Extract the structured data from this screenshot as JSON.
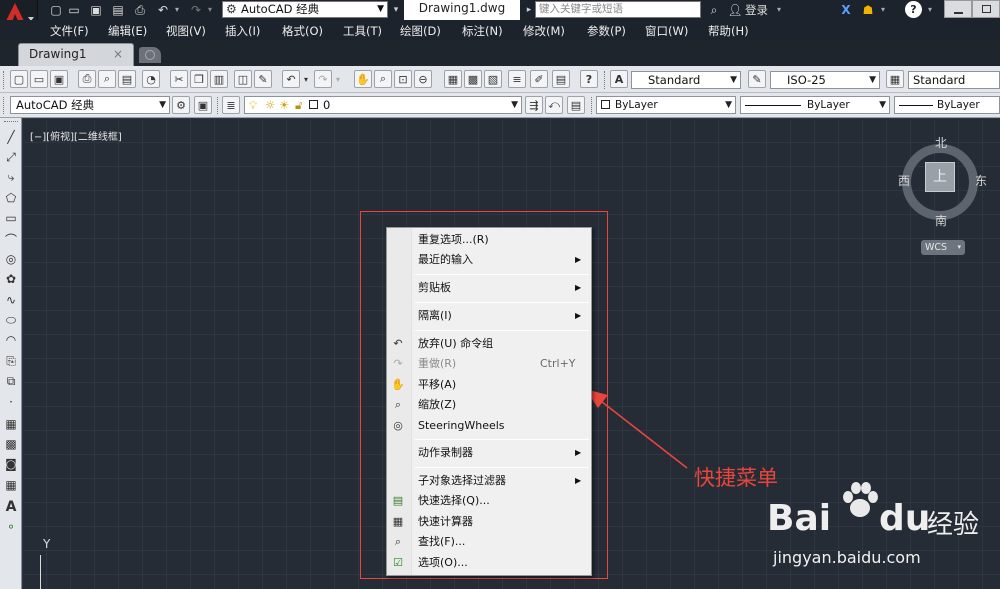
{
  "app": {
    "workspace": "AutoCAD 经典",
    "file_title": "Drawing1.dwg",
    "search_placeholder": "键入关键字或短语",
    "login": "登录"
  },
  "menubar": [
    "文件(F)",
    "编辑(E)",
    "视图(V)",
    "插入(I)",
    "格式(O)",
    "工具(T)",
    "绘图(D)",
    "标注(N)",
    "修改(M)",
    "参数(P)",
    "窗口(W)",
    "帮助(H)"
  ],
  "tabs": [
    {
      "label": "Drawing1",
      "close": "×"
    }
  ],
  "styles": {
    "text_style": "Standard",
    "dim_style": "ISO-25",
    "table_style": "Standard"
  },
  "toolbar2": {
    "workspace": "AutoCAD 经典",
    "layer": "0",
    "color": "ByLayer",
    "linetype": "ByLayer",
    "lineweight": "ByLayer"
  },
  "viewport_label": "[−][俯视][二维线框]",
  "viewcube": {
    "north": "北",
    "south": "南",
    "west": "西",
    "east": "东",
    "top": "上",
    "wcs": "WCS"
  },
  "ucs_y": "Y",
  "context_menu": {
    "repeat": "重复选项...(R)",
    "recent_input": "最近的输入",
    "clipboard": "剪贴板",
    "isolate": "隔离(I)",
    "undo": "放弃(U) 命令组",
    "redo": "重做(R)",
    "redo_shortcut": "Ctrl+Y",
    "pan": "平移(A)",
    "zoom": "缩放(Z)",
    "steering": "SteeringWheels",
    "action_recorder": "动作录制器",
    "subobject_filter": "子对象选择过滤器",
    "quick_select": "快速选择(Q)...",
    "quick_calc": "快速计算器",
    "find": "查找(F)...",
    "options": "选项(O)..."
  },
  "annotation": {
    "text": "快捷菜单",
    "color": "#e8453c"
  },
  "watermark": {
    "brand": "Bai",
    "brand2": "du",
    "cn": "经验",
    "url": "jingyan.baidu.com"
  },
  "colors": {
    "accent": "#e8453c",
    "canvas": "#252c36"
  }
}
